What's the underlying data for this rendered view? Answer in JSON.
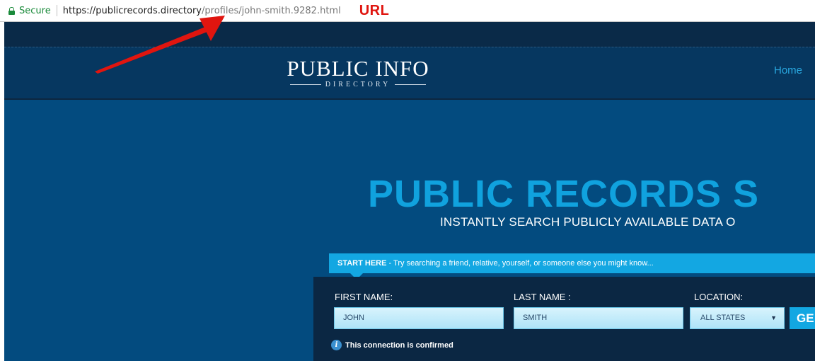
{
  "browser": {
    "secure_label": "Secure",
    "url_base": "https://publicrecords.directory",
    "url_path": "/profiles/john-smith.9282.html",
    "annotation_label": "URL",
    "annotation_color": "#e0150f"
  },
  "header": {
    "logo_title": "PUBLIC INFO",
    "logo_subtitle": "DIRECTORY",
    "nav": {
      "home_label": "Home"
    }
  },
  "hero": {
    "title": "PUBLIC RECORDS S",
    "subtitle": "INSTANTLY SEARCH PUBLICLY AVAILABLE DATA O",
    "banner_strong": "START HERE",
    "banner_text": " - Try searching a friend, relative, yourself, or someone else you might know..."
  },
  "search": {
    "first_name_label": "FIRST NAME:",
    "first_name_value": "JOHN",
    "last_name_label": "LAST NAME :",
    "last_name_value": "SMITH",
    "location_label": "LOCATION:",
    "location_value": "ALL STATES",
    "go_label": "GE",
    "confirm_text": "This connection is confirmed"
  },
  "colors": {
    "accent": "#10a2de",
    "header_bg": "#063760",
    "hero_bg": "#034b7f",
    "panel_bg": "#0b2743"
  }
}
